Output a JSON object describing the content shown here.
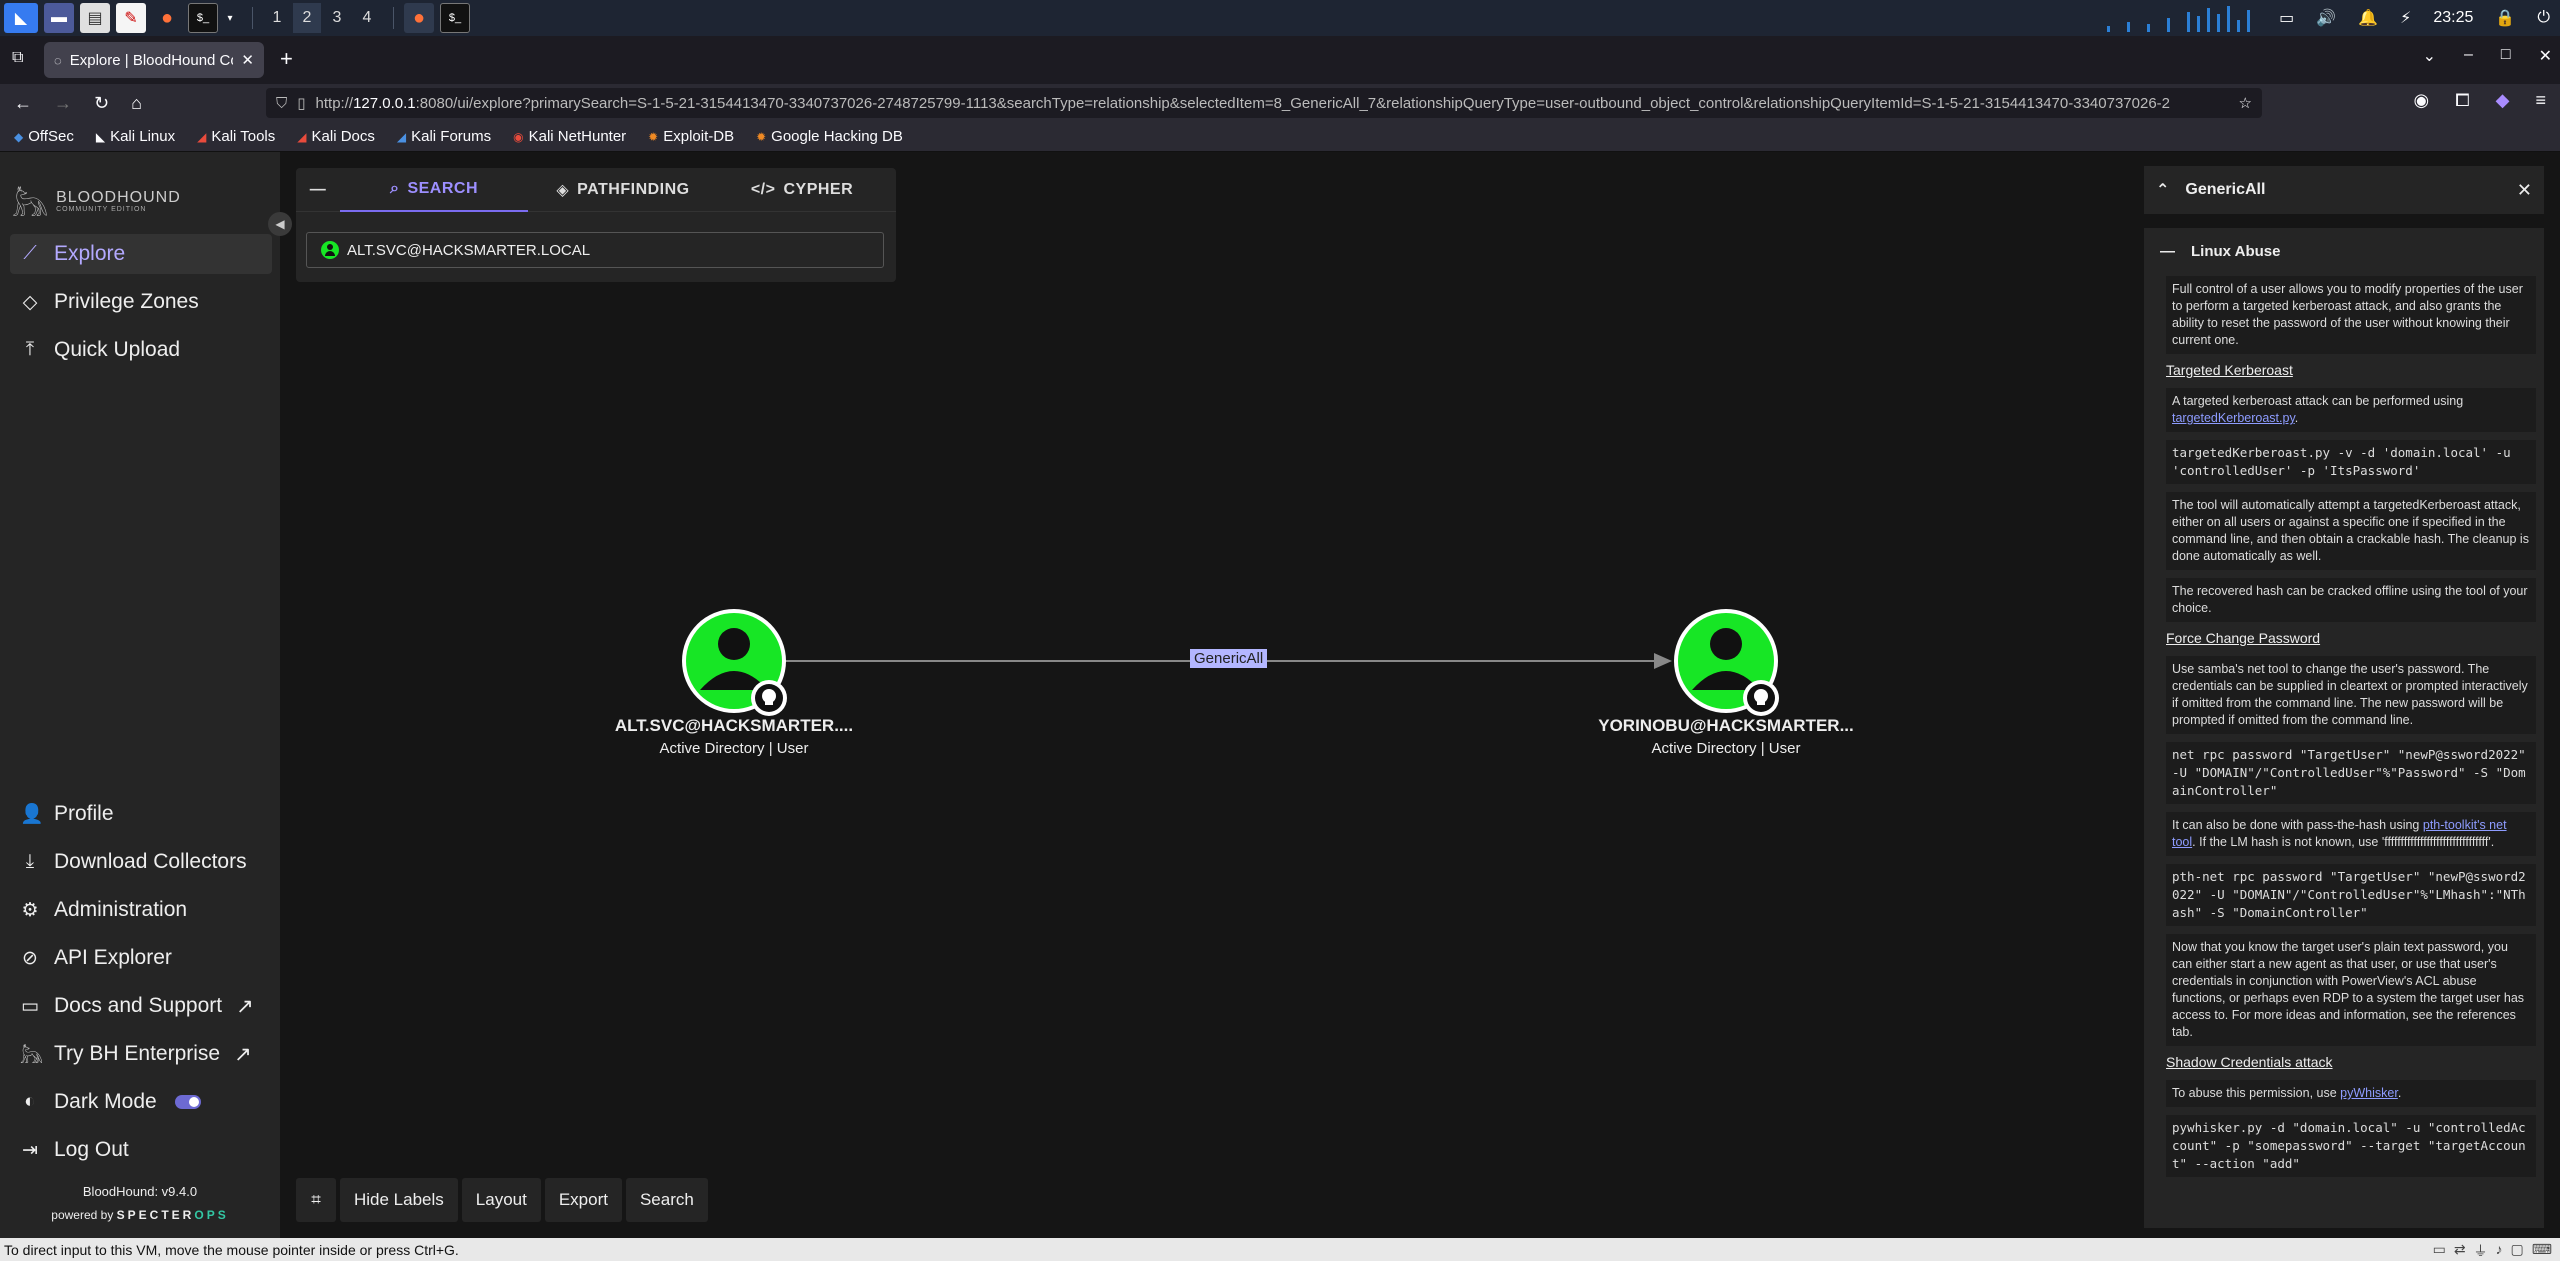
{
  "taskbar": {
    "workspaces": [
      "1",
      "2",
      "3",
      "4"
    ],
    "time": "23:25"
  },
  "browser": {
    "tab_title": "Explore | BloodHound Co",
    "url_prefix": "http://",
    "url_host": "127.0.0.1",
    "url_rest": ":8080/ui/explore?primarySearch=S-1-5-21-3154413470-3340737026-2748725799-1113&searchType=relationship&selectedItem=8_GenericAll_7&relationshipQueryType=user-outbound_object_control&relationshipQueryItemId=S-1-5-21-3154413470-3340737026-2",
    "bookmarks": [
      "OffSec",
      "Kali Linux",
      "Kali Tools",
      "Kali Docs",
      "Kali Forums",
      "Kali NetHunter",
      "Exploit-DB",
      "Google Hacking DB"
    ]
  },
  "sidebar": {
    "logo_title": "BLOODHOUND",
    "logo_sub": "COMMUNITY EDITION",
    "top_items": [
      {
        "label": "Explore"
      },
      {
        "label": "Privilege Zones"
      },
      {
        "label": "Quick Upload"
      }
    ],
    "bottom_items": [
      {
        "label": "Profile"
      },
      {
        "label": "Download Collectors"
      },
      {
        "label": "Administration"
      },
      {
        "label": "API Explorer"
      },
      {
        "label": "Docs and Support"
      },
      {
        "label": "Try BH Enterprise"
      },
      {
        "label": "Dark Mode"
      },
      {
        "label": "Log Out"
      }
    ],
    "version": "BloodHound: v9.4.0",
    "powered_by": "powered by",
    "brand_a": "SPECTER",
    "brand_b": "OPS"
  },
  "search_panel": {
    "collapse": "—",
    "tabs": [
      "SEARCH",
      "PATHFINDING",
      "CYPHER"
    ],
    "query": "ALT.SVC@HACKSMARTER.LOCAL"
  },
  "graph": {
    "source": {
      "name": "ALT.SVC@HACKSMARTER....",
      "type": "Active Directory | User"
    },
    "target": {
      "name": "YORINOBU@HACKSMARTER...",
      "type": "Active Directory | User"
    },
    "edge": "GenericAll",
    "node_color": "#17e625"
  },
  "toolbar": {
    "hide_labels": "Hide Labels",
    "layout": "Layout",
    "export": "Export",
    "search": "Search"
  },
  "right_panel": {
    "title": "GenericAll",
    "section": "Linux Abuse",
    "intro": "Full control of a user allows you to modify properties of the user to perform a targeted kerberoast attack, and also grants the ability to reset the password of the user without knowing their current one.",
    "h_kerberoast": "Targeted Kerberoast",
    "kerb_text": "A targeted kerberoast attack can be performed using",
    "kerb_link": "targetedKerberoast.py",
    "kerb_code": "targetedKerberoast.py -v -d 'domain.local' -u 'controlledUser' -p 'ItsPassword'",
    "kerb_text2": "The tool will automatically attempt a targetedKerberoast attack, either on all users or against a specific one if specified in the command line, and then obtain a crackable hash. The cleanup is done automatically as well.",
    "kerb_text3": "The recovered hash can be cracked offline using the tool of your choice.",
    "h_force": "Force Change Password",
    "force_text": "Use samba's net tool to change the user's password. The credentials can be supplied in cleartext or prompted interactively if omitted from the command line. The new password will be prompted if omitted from the command line.",
    "force_code": "net rpc password \"TargetUser\" \"newP@ssword2022\" -U \"DOMAIN\"/\"ControlledUser\"%\"Password\" -S \"DomainController\"",
    "pth_text_a": "It can also be done with pass-the-hash using",
    "pth_link": "pth-toolkit's net tool",
    "pth_text_b": ". If the LM hash is not known, use 'ffffffffffffffffffffffffffffffff'.",
    "pth_code": "pth-net rpc password \"TargetUser\" \"newP@ssword2022\" -U \"DOMAIN\"/\"ControlledUser\"%\"LMhash\":\"NThash\" -S \"DomainController\"",
    "force_text2": "Now that you know the target user's plain text password, you can either start a new agent as that user, or use that user's credentials in conjunction with PowerView's ACL abuse functions, or perhaps even RDP to a system the target user has access to. For more ideas and information, see the references tab.",
    "h_shadow": "Shadow Credentials attack",
    "shadow_text": "To abuse this permission, use",
    "shadow_link": "pyWhisker",
    "shadow_code": "pywhisker.py -d \"domain.local\" -u \"controlledAccount\" -p \"somepassword\" --target \"targetAccount\" --action \"add\""
  },
  "statusbar": {
    "text": "To direct input to this VM, move the mouse pointer inside or press Ctrl+G."
  }
}
